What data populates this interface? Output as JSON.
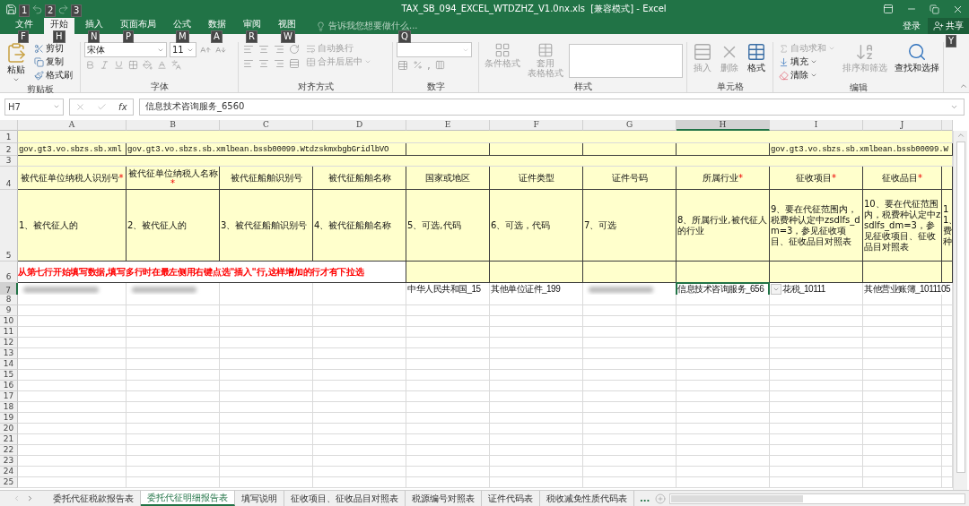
{
  "quick_access": [
    {
      "keytip": "1",
      "disabled": false
    },
    {
      "keytip": "2",
      "disabled": true
    },
    {
      "keytip": "3",
      "disabled": true
    }
  ],
  "window": {
    "title": "TAX_SB_094_EXCEL_WTDZHZ_V1.0nx.xls  [兼容模式] - Excel"
  },
  "tabs": [
    {
      "label": "文件",
      "keytip": "F",
      "selected": false
    },
    {
      "label": "开始",
      "keytip": "H",
      "selected": true
    },
    {
      "label": "插入",
      "keytip": "N",
      "selected": false
    },
    {
      "label": "页面布局",
      "keytip": "P",
      "selected": false
    },
    {
      "label": "公式",
      "keytip": "M",
      "selected": false
    },
    {
      "label": "数据",
      "keytip": "A",
      "selected": false
    },
    {
      "label": "审阅",
      "keytip": "R",
      "selected": false
    },
    {
      "label": "视图",
      "keytip": "W",
      "selected": false
    }
  ],
  "tell_me": {
    "placeholder": "告诉我您想要做什么...",
    "keytip": "Q"
  },
  "account": {
    "login": "登录",
    "share": "共享",
    "share_keytip": "Y"
  },
  "ribbon": {
    "groups": [
      {
        "label": "剪贴板",
        "items": [
          {
            "label": "粘贴",
            "disabled": false
          },
          {
            "label": "剪切",
            "disabled": false
          },
          {
            "label": "复制",
            "disabled": false
          },
          {
            "label": "格式刷",
            "disabled": false
          }
        ]
      },
      {
        "label": "字体",
        "font_name": "宋体",
        "font_size": "11"
      },
      {
        "label": "对齐方式",
        "items": [
          {
            "label": "自动换行",
            "disabled": true
          },
          {
            "label": "合并后居中",
            "disabled": true
          }
        ]
      },
      {
        "label": "数字",
        "comma": ","
      },
      {
        "label": "样式",
        "items": [
          {
            "lines": [
              "条件格式"
            ],
            "disabled": true
          },
          {
            "lines": [
              "套用",
              "表格格式"
            ],
            "disabled": true
          }
        ]
      },
      {
        "label": "单元格",
        "items": [
          {
            "label": "插入",
            "disabled": true
          },
          {
            "label": "删除",
            "disabled": true
          },
          {
            "label": "格式",
            "disabled": false
          }
        ]
      },
      {
        "label": "编辑",
        "items": [
          {
            "label": "自动求和",
            "disabled": true
          },
          {
            "label": "填充",
            "disabled": false
          },
          {
            "label": "清除",
            "disabled": false
          },
          {
            "label": "排序和筛选",
            "disabled": true
          },
          {
            "label": "查找和选择",
            "disabled": false
          }
        ]
      }
    ]
  },
  "formula_bar": {
    "name_box": "H7",
    "fx": "fx",
    "formula": "信息技术咨询服务_6560"
  },
  "sheet": {
    "columns": [
      {
        "label": "A",
        "selected": false
      },
      {
        "label": "B",
        "selected": false
      },
      {
        "label": "C",
        "selected": false
      },
      {
        "label": "D",
        "selected": false
      },
      {
        "label": "E",
        "selected": false
      },
      {
        "label": "F",
        "selected": false
      },
      {
        "label": "G",
        "selected": false
      },
      {
        "label": "H",
        "selected": true
      },
      {
        "label": "I",
        "selected": false
      },
      {
        "label": "J",
        "selected": false
      }
    ],
    "rows": [
      {
        "number": "1",
        "selected": false,
        "cells": [
          {
            "kind": "band"
          }
        ]
      },
      {
        "number": "2",
        "selected": false,
        "cells": [
          {
            "kind": "code",
            "text": "gov.gt3.vo.sbzs.sb.xml"
          },
          {
            "kind": "code",
            "text": "gov.gt3.vo.sbzs.sb.xmlbean.bssb00099.WtdzskmxbgbGridlbVO"
          },
          {
            "kind": "code"
          },
          {
            "kind": "code"
          },
          {
            "kind": "code"
          },
          {
            "kind": "code"
          },
          {
            "kind": "code",
            "text": "gov.gt3.vo.sbzs.sb.xmlbean.bssb00099.W"
          }
        ]
      },
      {
        "number": "3",
        "selected": false,
        "cells": [
          {
            "kind": "band"
          }
        ]
      },
      {
        "number": "4",
        "selected": false,
        "cells": [
          {
            "kind": "header",
            "text": "被代征单位纳税人识别号",
            "mark": "*"
          },
          {
            "kind": "header",
            "text": "被代征单位纳税人名称",
            "mark": "*"
          },
          {
            "kind": "header",
            "text": "被代征船舶识别号"
          },
          {
            "kind": "header",
            "text": "被代征船舶名称"
          },
          {
            "kind": "header",
            "text": "国家或地区"
          },
          {
            "kind": "header",
            "text": "证件类型"
          },
          {
            "kind": "header",
            "text": "证件号码"
          },
          {
            "kind": "header",
            "text": "所属行业",
            "mark": "*"
          },
          {
            "kind": "header",
            "text": "征收项目",
            "mark": "*"
          },
          {
            "kind": "header",
            "text": "征收品目",
            "mark": "*"
          },
          {
            "kind": "header"
          }
        ]
      },
      {
        "number": "5",
        "selected": false,
        "cells": [
          {
            "kind": "note",
            "text": "1、被代征人的"
          },
          {
            "kind": "note",
            "text": "2、被代征人的"
          },
          {
            "kind": "note",
            "text": "3、被代征船舶识别号"
          },
          {
            "kind": "note",
            "text": "4、被代征船舶名称"
          },
          {
            "kind": "note",
            "text": "5、可选,代码"
          },
          {
            "kind": "note",
            "text": "6、可选，代码"
          },
          {
            "kind": "note",
            "text": "7、可选"
          },
          {
            "kind": "note",
            "text": "8、所属行业,被代征人的行业"
          },
          {
            "kind": "note",
            "text": "9、要在代征范围内，税费种认定中zsdlfs_dm=3，参见征收项目、征收品目对照表"
          },
          {
            "kind": "note",
            "text": "10、要在代征范围内，税费种认定中zsdlfs_dm=3，参见征收项目、征收品目对照表"
          },
          {
            "kind": "note",
            "text": "11、费种"
          }
        ]
      },
      {
        "number": "6",
        "selected": false,
        "cells": [
          {
            "kind": "warning",
            "text": "从第七行开始填写数据,填写多行时在最左侧用右键点选\"插入\"行,这样增加的行才有下拉选"
          },
          {
            "kind": "header"
          },
          {
            "kind": "header"
          },
          {
            "kind": "header"
          },
          {
            "kind": "header"
          },
          {
            "kind": "header"
          },
          {
            "kind": "header"
          },
          {
            "kind": "header"
          }
        ]
      },
      {
        "number": "7",
        "selected": true,
        "cells": [
          {
            "kind": "data",
            "blurred": true
          },
          {
            "kind": "data",
            "blurred": true
          },
          {
            "kind": "data"
          },
          {
            "kind": "data"
          },
          {
            "kind": "data",
            "text": "中华人民共和国_15"
          },
          {
            "kind": "data",
            "text": "其他单位证件_199"
          },
          {
            "kind": "data",
            "blurred": true
          },
          {
            "kind": "data",
            "text": "信息技术咨询服务_656",
            "selected": true,
            "dropdown": true
          },
          {
            "kind": "data",
            "text": "花税_10111"
          },
          {
            "kind": "data",
            "text": "其他营业账簿_1011105"
          }
        ]
      },
      {
        "number": "8",
        "selected": false
      },
      {
        "number": "9",
        "selected": false
      },
      {
        "number": "10",
        "selected": false
      },
      {
        "number": "11",
        "selected": false
      },
      {
        "number": "12",
        "selected": false
      },
      {
        "number": "13",
        "selected": false
      },
      {
        "number": "14",
        "selected": false
      },
      {
        "number": "15",
        "selected": false
      },
      {
        "number": "16",
        "selected": false
      },
      {
        "number": "17",
        "selected": false
      },
      {
        "number": "18",
        "selected": false
      },
      {
        "number": "19",
        "selected": false
      },
      {
        "number": "20",
        "selected": false
      },
      {
        "number": "21",
        "selected": false
      },
      {
        "number": "22",
        "selected": false
      },
      {
        "number": "23",
        "selected": false
      },
      {
        "number": "24",
        "selected": false
      },
      {
        "number": "25",
        "selected": false
      }
    ]
  },
  "sheet_tabs": [
    {
      "label": "委托代征税款报告表",
      "selected": false
    },
    {
      "label": "委托代征明细报告表",
      "selected": true
    },
    {
      "label": "填写说明",
      "selected": false
    },
    {
      "label": "征收项目、征收品目对照表",
      "selected": false
    },
    {
      "label": "税源编号对照表",
      "selected": false
    },
    {
      "label": "证件代码表",
      "selected": false
    },
    {
      "label": "税收减免性质代码表",
      "selected": false
    }
  ],
  "more_tabs": "..."
}
